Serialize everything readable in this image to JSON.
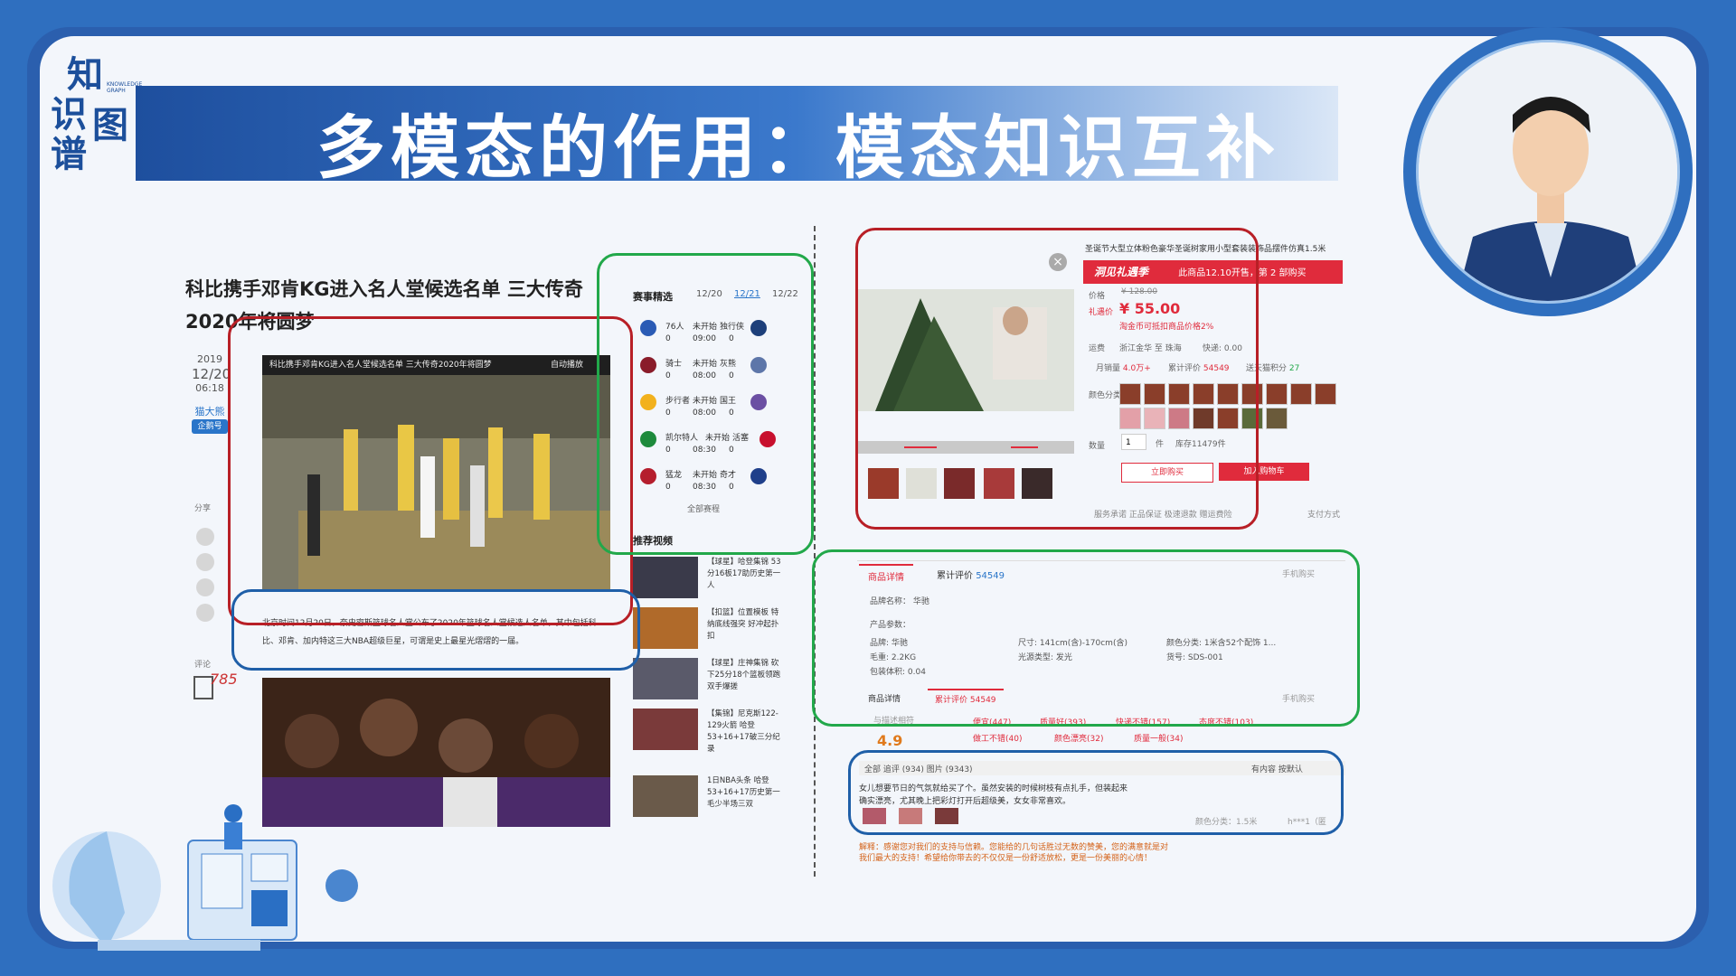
{
  "slide": {
    "title": "多模态的作用：模态知识互补",
    "logo": {
      "chars": [
        "知",
        "识",
        "图",
        "谱"
      ],
      "mini": "KNOWLEDGE GRAPH"
    }
  },
  "news": {
    "title": "科比携手邓肯KG进入名人堂候选名单 三大传奇2020年将圆梦",
    "date_year": "2019",
    "date_day": "12/20",
    "date_time": "06:18",
    "source": "猫大熊",
    "source_badge": "企鹅号",
    "share_label": "分享",
    "comment_label": "评论",
    "comment_count": "785",
    "video_title": "科比携手邓肯KG进入名人堂候选名单 三大传奇2020年将圆梦",
    "autoplay_label": "自动播放",
    "body": "北京时间12月20日，奈史密斯篮球名人堂公布了2020年篮球名人堂候选人名单，其中包括科比、邓肯、加内特这三大NBA超级巨星，可谓是史上最星光熠熠的一届。"
  },
  "schedule": {
    "heading": "赛事精选",
    "dates": [
      "12/20",
      "12/21",
      "12/22"
    ],
    "games": [
      {
        "home": "76人",
        "status": "未开始",
        "away": "独行侠",
        "time": "09:00",
        "home_score": "0",
        "away_score": "0"
      },
      {
        "home": "骑士",
        "status": "未开始",
        "away": "灰熊",
        "time": "08:00",
        "home_score": "0",
        "away_score": "0"
      },
      {
        "home": "步行者",
        "status": "未开始",
        "away": "国王",
        "time": "08:00",
        "home_score": "0",
        "away_score": "0"
      },
      {
        "home": "凯尔特人",
        "status": "未开始",
        "away": "活塞",
        "time": "08:30",
        "home_score": "0",
        "away_score": "0"
      },
      {
        "home": "猛龙",
        "status": "未开始",
        "away": "奇才",
        "time": "08:30",
        "home_score": "0",
        "away_score": "0"
      }
    ],
    "all_label": "全部赛程",
    "recommend_heading": "推荐视频",
    "videos": [
      "【球星】哈登集锦 53分16板17助历史第一人",
      "【扣篮】位置模板 特纳底线强突 好冲起扑扣",
      "【球星】庄神集锦 砍下25分18个篮板领跑双手爆搓",
      "【集锦】尼克斯122-129火箭 哈登53+16+17破三分纪录",
      "1日NBA头条 哈登53+16+17历史第一 毛少半场三双"
    ]
  },
  "product": {
    "title": "圣诞节大型立体粉色豪华圣诞树家用小型套装装饰品摆件仿真1.5米",
    "promo": "此商品12.10开售，第 2 部购买",
    "promo_logo": "洞见礼遇季",
    "price_label": "价格",
    "price_old": "¥ 128.00",
    "price_promo_label": "礼遇价",
    "price": "¥ 55.00",
    "coupon_note": "淘金币可抵扣商品价格2%",
    "ship_label": "运费",
    "ship_from": "浙江金华 至 珠海",
    "ship_fee": "快递: 0.00",
    "sales_label": "月销量",
    "sales": "4.0万+",
    "reviews_label": "累计评价",
    "reviews": "54549",
    "points_label": "送天猫积分",
    "points": "27",
    "color_label": "颜色分类",
    "qty_label": "数量",
    "qty": "1",
    "qty_unit": "件",
    "stock": "库存11479件",
    "buy_label": "立即购买",
    "cart_label": "加入购物车",
    "service": "服务承诺 正品保证  极速退款  赠运费险",
    "pay_label": "支付方式",
    "detail_tab": "商品详情",
    "review_tab": "累计评价",
    "review_count": "54549",
    "mobile_label": "手机购买",
    "brand_name_label": "品牌名称：",
    "brand_name": "华驰",
    "params_label": "产品参数：",
    "params": [
      "品牌: 华驰",
      "尺寸: 141cm(含)-170cm(含)",
      "颜色分类: 1米含52个配饰 1...",
      "毛重: 2.2KG",
      "光源类型: 发光",
      "货号: SDS-001",
      "包装体积: 0.04"
    ],
    "rating": "4.9",
    "rating_label": "与描述相符",
    "tags": [
      "便宜(447)",
      "质量好(393)",
      "快递不错(157)",
      "态度不错(103)",
      "做工不错(40)",
      "颜色漂亮(32)",
      "质量一般(34)"
    ],
    "filter": "全部   追评 (934)   图片 (9343)",
    "filter_right": "有内容   按默认",
    "review_text": "女儿想要节日的气氛就给买了个。虽然安装的时候树枝有点扎手，但装起来确实漂亮，尤其晚上把彩灯打开后超级美，女女非常喜欢。",
    "review_meta": "颜色分类：1.5米",
    "review_user": "h***1（匿",
    "reply": "解释：感谢您对我们的支持与信赖。您能给的几句话胜过无数的赞美，您的满意就是对我们最大的支持！希望给你带去的不仅仅是一份舒适放松，更是一份美丽的心情！"
  },
  "colors": {
    "accent_red": "#b81f26",
    "accent_green": "#22a84a",
    "accent_blue": "#1f5fa8",
    "brand_blue": "#2b5fae",
    "price_red": "#e02b3c"
  }
}
